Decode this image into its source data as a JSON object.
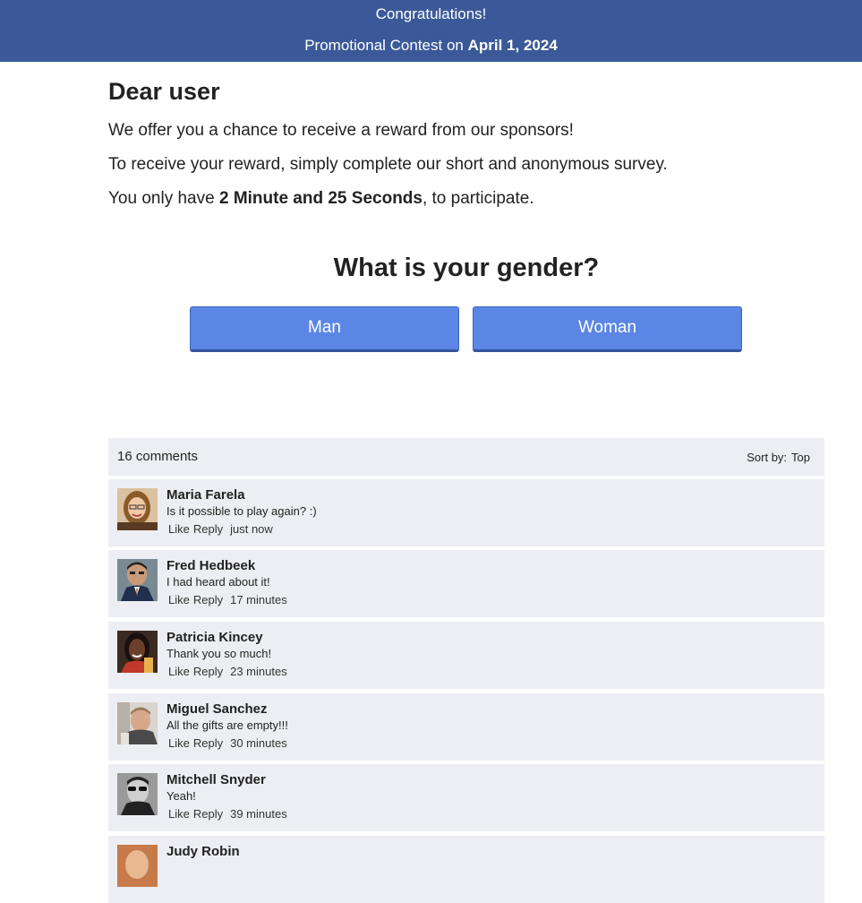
{
  "banner": {
    "line1": "Congratulations!",
    "line2_prefix": "Promotional Contest on ",
    "line2_date": "April 1, 2024",
    "background_color": "#3b5998"
  },
  "intro": {
    "greeting": "Dear user",
    "paragraph1": "We offer you a chance to receive a reward from our sponsors!",
    "paragraph2": "To receive your reward, simply complete our short and anonymous survey.",
    "paragraph3_prefix": "You only have ",
    "paragraph3_time": "2 Minute and 25 Seconds",
    "paragraph3_suffix": ", to participate."
  },
  "survey": {
    "question": "What is your gender?",
    "options": [
      "Man",
      "Woman"
    ],
    "button_color": "#5b86e5"
  },
  "comments": {
    "count_label": "16 comments",
    "sort_label": "Sort by:",
    "sort_value": "Top",
    "like_label": "Like",
    "reply_label": "Reply",
    "items": [
      {
        "name": "Maria Farela",
        "text": "Is it possible to play again? :)",
        "time": "just now",
        "avatar": "avatar-maria-farela"
      },
      {
        "name": "Fred Hedbeek",
        "text": "I had heard about it!",
        "time": "17 minutes",
        "avatar": "avatar-fred-hedbeek"
      },
      {
        "name": "Patricia Kincey",
        "text": "Thank you so much!",
        "time": "23 minutes",
        "avatar": "avatar-patricia-kincey"
      },
      {
        "name": "Miguel Sanchez",
        "text": "All the gifts are empty!!!",
        "time": "30 minutes",
        "avatar": "avatar-miguel-sanchez"
      },
      {
        "name": "Mitchell Snyder",
        "text": "Yeah!",
        "time": "39 minutes",
        "avatar": "avatar-mitchell-snyder"
      },
      {
        "name": "Judy Robin",
        "text": "",
        "time": "",
        "avatar": "avatar-judy-robin"
      }
    ]
  }
}
